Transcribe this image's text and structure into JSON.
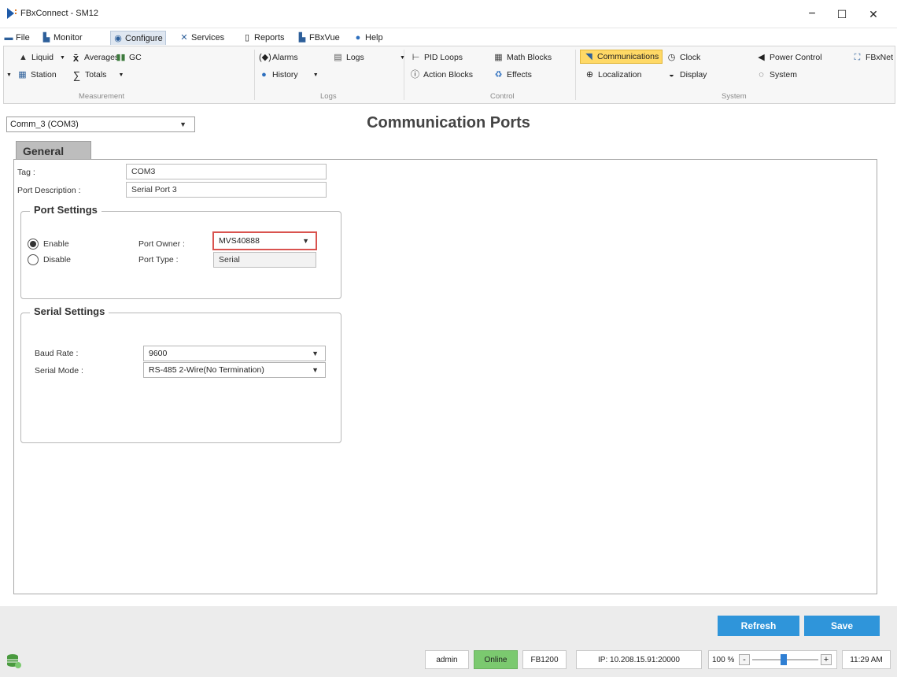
{
  "window": {
    "title": "FBxConnect - SM12",
    "minimize": "−",
    "maximize": "☐",
    "close": "✕"
  },
  "menu": [
    {
      "label": "File",
      "icon": "folder-icon"
    },
    {
      "label": "Monitor",
      "icon": "monitor-icon"
    },
    {
      "label": "Configure",
      "icon": "configure-icon"
    },
    {
      "label": "Services",
      "icon": "services-icon"
    },
    {
      "label": "Reports",
      "icon": "reports-icon"
    },
    {
      "label": "FBxVue",
      "icon": "fbxvue-icon"
    },
    {
      "label": "Help",
      "icon": "help-icon"
    }
  ],
  "ribbon": {
    "measurement": {
      "group_label": "Measurement",
      "items": [
        "Liquid",
        "Averages",
        "GC",
        "Station",
        "Totals"
      ]
    },
    "logs": {
      "group_label": "Logs",
      "items": [
        "Alarms",
        "Logs",
        "History"
      ]
    },
    "control": {
      "group_label": "Control",
      "items": [
        "PID Loops",
        "Math Blocks",
        "Action Blocks",
        "Effects"
      ]
    },
    "system": {
      "group_label": "System",
      "items": [
        "Communications",
        "Clock",
        "Power Control",
        "FBxNet",
        "Localization",
        "Display",
        "System"
      ]
    }
  },
  "header": {
    "port_selector": "Comm_3 (COM3)",
    "page_title": "Communication Ports"
  },
  "tabs": {
    "general": "General"
  },
  "general": {
    "tag_label": "Tag :",
    "tag_value": "COM3",
    "desc_label": "Port Description :",
    "desc_value": "Serial Port 3"
  },
  "port_settings": {
    "title": "Port Settings",
    "enable_label": "Enable",
    "disable_label": "Disable",
    "selected": "Enable",
    "owner_label": "Port Owner :",
    "owner_value": "MVS40888",
    "type_label": "Port Type :",
    "type_value": "Serial",
    "highlight_color": "#d9534f"
  },
  "serial_settings": {
    "title": "Serial Settings",
    "baud_label": "Baud Rate :",
    "baud_value": "9600",
    "mode_label": "Serial Mode :",
    "mode_value": "RS-485 2-Wire(No Termination)"
  },
  "footer": {
    "refresh": "Refresh",
    "save": "Save",
    "accent": "#2f95da"
  },
  "status": {
    "user": "admin",
    "connection": "Online",
    "device": "FB1200",
    "ip": "IP: 10.208.15.91:20000",
    "zoom": "100 %",
    "zoom_minus": "-",
    "zoom_plus": "+",
    "time": "11:29 AM",
    "online_color": "#7bc96f"
  }
}
